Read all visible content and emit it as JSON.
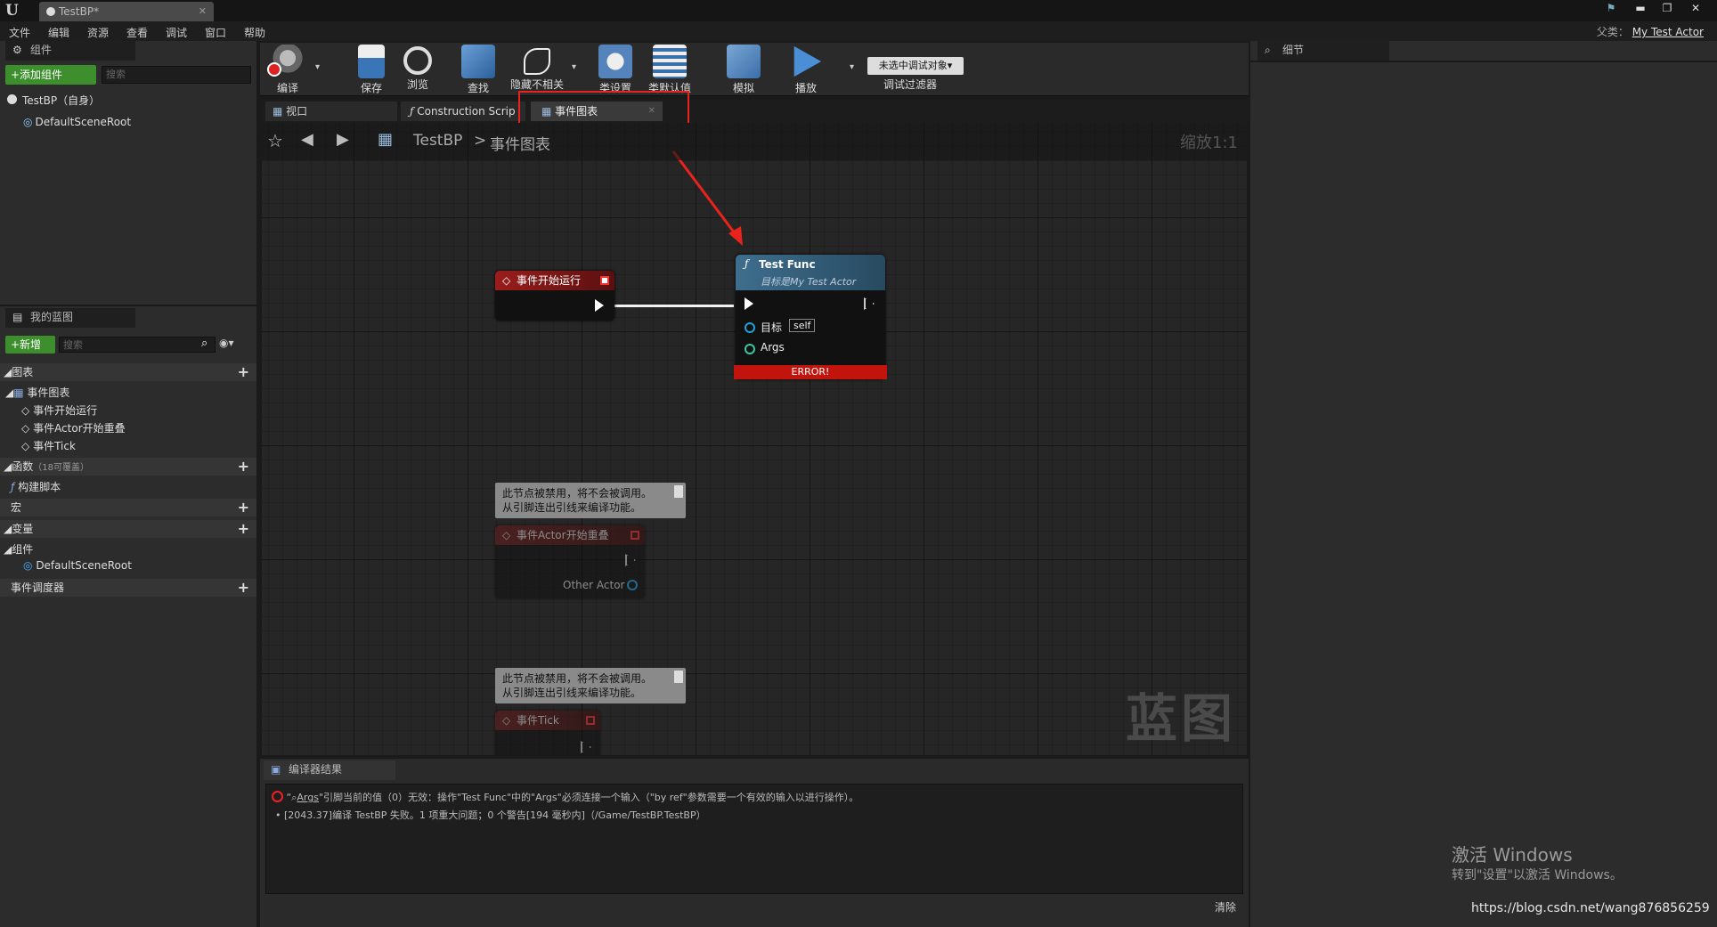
{
  "window": {
    "tab_title": "TestBP*",
    "parent_label": "父类：",
    "parent_value": "My Test Actor"
  },
  "menu": [
    "文件",
    "编辑",
    "资源",
    "查看",
    "调试",
    "窗口",
    "帮助"
  ],
  "components": {
    "tab": "组件",
    "add_button": "+添加组件",
    "search_placeholder": "搜索",
    "self_item": "TestBP（自身）",
    "root_item": "DefaultSceneRoot"
  },
  "my_blueprint": {
    "tab": "我的蓝图",
    "new_button": "+新增",
    "search_placeholder": "搜索",
    "graphs_section": "图表",
    "event_graph": "事件图表",
    "events": [
      "事件开始运行",
      "事件Actor开始重叠",
      "事件Tick"
    ],
    "functions_section": "函数",
    "functions_note": "（18可覆盖）",
    "construction": "构建脚本",
    "macros_section": "宏",
    "variables_section": "变量",
    "components_group": "组件",
    "component_var": "DefaultSceneRoot",
    "dispatchers_section": "事件调度器"
  },
  "toolbar": {
    "compile": "编译",
    "save": "保存",
    "browse": "浏览",
    "find": "查找",
    "hide": "隐藏不相关",
    "class_settings": "类设置",
    "class_defaults": "类默认值",
    "simulate": "模拟",
    "play": "播放",
    "debug_select": "未选中调试对象▾",
    "debug_filter": "调试过滤器"
  },
  "tabs": {
    "viewport": "视口",
    "construction": "Construction Scrip",
    "event_graph": "事件图表"
  },
  "breadcrumb": {
    "root": "TestBP",
    "sep": ">",
    "current": "事件图表",
    "zoom": "缩放1:1"
  },
  "nodes": {
    "begin_play": "事件开始运行",
    "test_func_title": "Test Func",
    "test_func_sub": "目标是My Test Actor",
    "target_label": "目标",
    "target_value": "self",
    "args_label": "Args",
    "error": "ERROR!",
    "disabled_comment_1": "此节点被禁用，将不会被调用。",
    "disabled_comment_2": "从引脚连出引线来编译功能。",
    "overlap": "事件Actor开始重叠",
    "other_actor": "Other Actor",
    "tick": "事件Tick"
  },
  "watermark": "蓝图",
  "details": {
    "tab": "细节"
  },
  "compiler": {
    "tab": "编译器结果",
    "line1_arg": "Args",
    "line1": "\"引脚当前的值（0）无效：操作\"Test Func\"中的\"Args\"必须连接一个输入（\"by ref\"参数需要一个有效的输入以进行操作）。",
    "line2": "[2043.37]编译 TestBP 失败。1 项重大问题；0 个警告[194 毫秒内]（/Game/TestBP.TestBP）",
    "clear": "清除"
  },
  "overlay": {
    "activate_title": "激活 Windows",
    "activate_sub": "转到\"设置\"以激活 Windows。",
    "url": "https://blog.csdn.net/wang876856259"
  },
  "colors": {
    "accent_green": "#3c8f2c",
    "error_red": "#c0140c",
    "annotation_red": "#e8231b"
  }
}
